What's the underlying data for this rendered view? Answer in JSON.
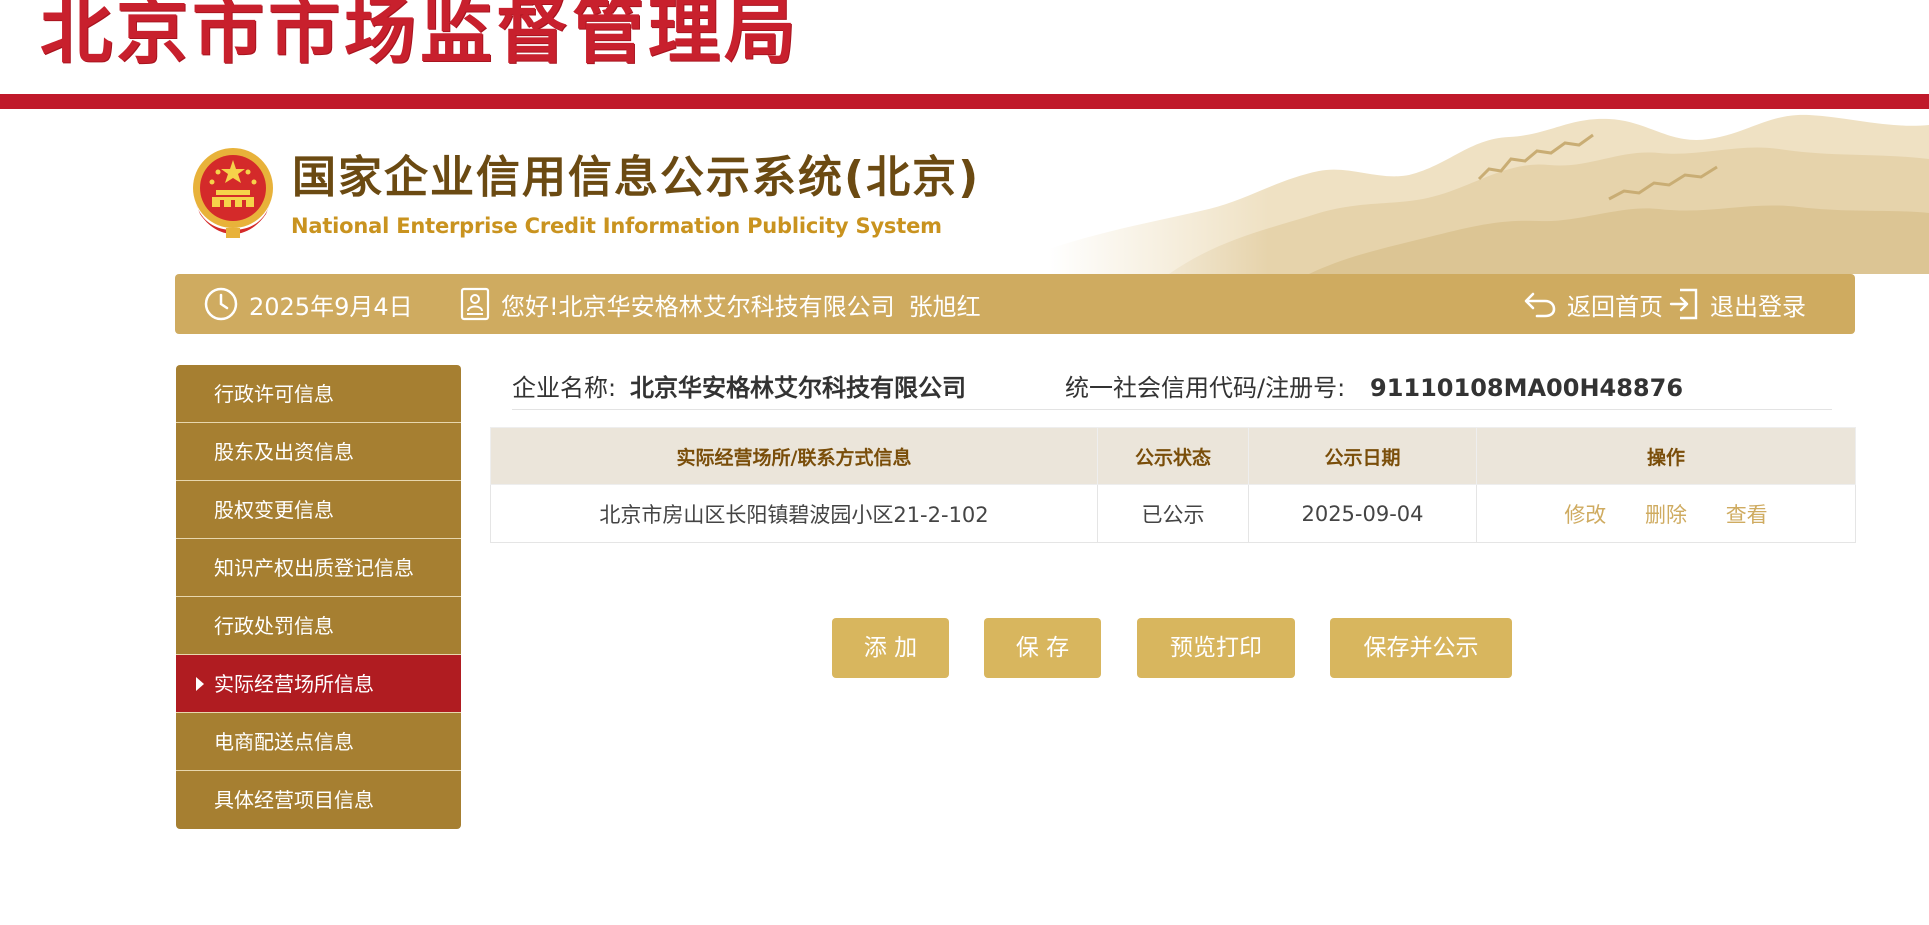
{
  "agency": {
    "title": "北京市市场监督管理局"
  },
  "system": {
    "title_cn": "国家企业信用信息公示系统(北京)",
    "title_en": "National Enterprise Credit Information Publicity System"
  },
  "info_bar": {
    "date": "2025年9月4日",
    "greeting": "您好!",
    "company": "北京华安格林艾尔科技有限公司",
    "user": "张旭红",
    "home_label": "返回首页",
    "logout_label": "退出登录",
    "date_icon": "clock-icon",
    "user_icon": "user-badge-icon",
    "home_icon": "return-arrow-icon",
    "logout_icon": "logout-icon"
  },
  "sidebar": {
    "items": [
      {
        "label": "行政许可信息",
        "active": false
      },
      {
        "label": "股东及出资信息",
        "active": false
      },
      {
        "label": "股权变更信息",
        "active": false
      },
      {
        "label": "知识产权出质登记信息",
        "active": false
      },
      {
        "label": "行政处罚信息",
        "active": false
      },
      {
        "label": "实际经营场所信息",
        "active": true
      },
      {
        "label": "电商配送点信息",
        "active": false
      },
      {
        "label": "具体经营项目信息",
        "active": false
      }
    ]
  },
  "company_info": {
    "name_label": "企业名称:",
    "name_value": "北京华安格林艾尔科技有限公司",
    "code_label": "统一社会信用代码/注册号:",
    "code_value": "91110108MA00H48876"
  },
  "table": {
    "headers": [
      "实际经营场所/联系方式信息",
      "公示状态",
      "公示日期",
      "操作"
    ],
    "rows": [
      {
        "address": "北京市房山区长阳镇碧波园小区21-2-102",
        "status": "已公示",
        "date": "2025-09-04",
        "actions": [
          "修改",
          "删除",
          "查看"
        ]
      }
    ]
  },
  "buttons": {
    "add": "添 加",
    "save": "保 存",
    "preview": "预览打印",
    "save_publish": "保存并公示"
  },
  "colors": {
    "brand_red": "#c0192a",
    "gold_bar": "#cfab60",
    "sidebar_gold": "#a67f31",
    "sidebar_active": "#b01c21",
    "button_gold": "#d8b65e",
    "header_brown": "#6b4a12"
  }
}
